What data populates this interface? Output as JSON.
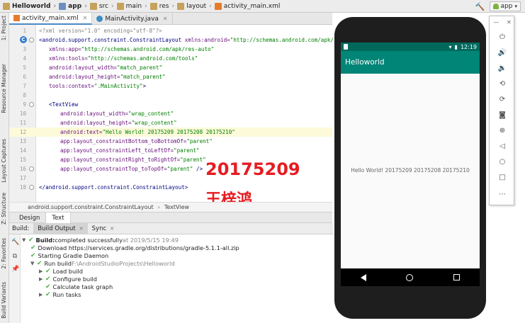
{
  "breadcrumb": [
    {
      "label": "Helloworld",
      "icon": "folder-icon",
      "bold": true
    },
    {
      "label": "app",
      "icon": "folder-icon",
      "bold": true
    },
    {
      "label": "src",
      "icon": "folder-icon"
    },
    {
      "label": "main",
      "icon": "folder-icon"
    },
    {
      "label": "res",
      "icon": "folder-icon"
    },
    {
      "label": "layout",
      "icon": "folder-icon"
    },
    {
      "label": "activity_main.xml",
      "icon": "xml-file-icon"
    }
  ],
  "run_config": {
    "label": "app"
  },
  "editor_tabs": [
    {
      "label": "activity_main.xml",
      "active": true
    },
    {
      "label": "MainActivity.java",
      "active": false
    }
  ],
  "left_tool_tabs": {
    "project": "1: Project",
    "resource_manager": "Resource Manager",
    "layout_captures": "Layout Captures",
    "structure": "Z: Structure",
    "favorites": "2: Favorites",
    "build_variants": "Build Variants"
  },
  "code": {
    "line1": "<?xml version=\"1.0\" encoding=\"utf-8\"?>",
    "line2_tag": "<android.support.constraint.ConstraintLayout",
    "line2_attr": " xmlns:android=",
    "line2_val": "\"http://schemas.android.com/apk/res/android\"",
    "line3_attr": "xmlns:app=",
    "line3_val": "\"http://schemas.android.com/apk/res-auto\"",
    "line4_attr": "xmlns:tools=",
    "line4_val": "\"http://schemas.android.com/tools\"",
    "line5_attr": "android:layout_width=",
    "line5_val": "\"match_parent\"",
    "line6_attr": "android:layout_height=",
    "line6_val": "\"match_parent\"",
    "line7_attr": "tools:context=",
    "line7_val": "\".MainActivity\"",
    "line7_end": ">",
    "line9_tag": "<TextView",
    "line10_attr": "android:layout_width=",
    "line10_val": "\"wrap_content\"",
    "line11_attr": "android:layout_height=",
    "line11_val": "\"wrap_content\"",
    "line12_attr": "android:text=",
    "line12_val": "\"Hello World! 20175209 20175208 20175210\"",
    "line13_attr": "app:layout_constraintBottom_toBottomOf=",
    "line13_val": "\"parent\"",
    "line14_attr": "app:layout_constraintLeft_toLeftOf=",
    "line14_val": "\"parent\"",
    "line15_attr": "app:layout_constraintRight_toRightOf=",
    "line15_val": "\"parent\"",
    "line16_attr": "app:layout_constraintTop_toTopOf=",
    "line16_val": "\"parent\"",
    "line16_end": " />",
    "line18_tag": "</android.support.constraint.ConstraintLayout>",
    "line_numbers": [
      "1",
      "2",
      "3",
      "4",
      "5",
      "6",
      "7",
      "8",
      "9",
      "10",
      "11",
      "12",
      "13",
      "14",
      "15",
      "16",
      "17",
      "18"
    ]
  },
  "annotation": {
    "number": "20175209",
    "name": "王梓鸿"
  },
  "crumb_footer": {
    "parent": "android.support.constraint.ConstraintLayout",
    "child": "TextView"
  },
  "design_tabs": {
    "design": "Design",
    "text": "Text"
  },
  "build_panel": {
    "label": "Build:",
    "tabs": [
      {
        "label": "Build Output",
        "active": true
      },
      {
        "label": "Sync",
        "active": false
      }
    ],
    "rows": {
      "r1_bold": "Build:",
      "r1_text": " completed successfully",
      "r1_muted": " at 2019/5/15 19:49",
      "r2": "Download https://services.gradle.org/distributions/gradle-5.1.1-all.zip",
      "r3": "Starting Gradle Daemon",
      "r4": "Run build",
      "r4_muted": " F:\\AndroidStudioProjects\\Helloworld",
      "r5": "Load build",
      "r6": "Configure build",
      "r7": "Calculate task graph",
      "r8": "Run tasks"
    }
  },
  "emulator": {
    "time": "12:19",
    "app_title": "Helloworld",
    "hello_text": "Hello World! 20175209 20175208 20175210"
  },
  "colors": {
    "status_bar": "#00695c",
    "app_bar": "#008577",
    "annotation": "#e51c23"
  }
}
